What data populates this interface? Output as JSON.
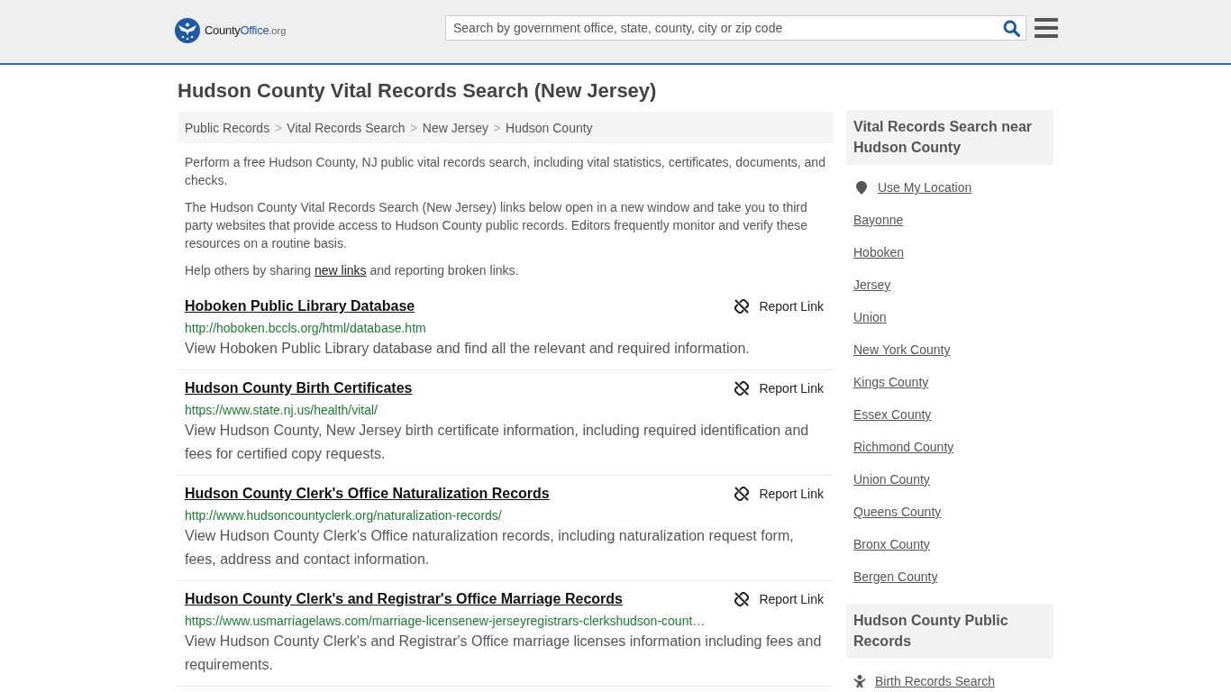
{
  "header": {
    "logo": {
      "county": "County",
      "office": "Office",
      "suffix": ".org"
    },
    "search": {
      "placeholder": "Search by government office, state, county, city or zip code"
    }
  },
  "title": "Hudson County Vital Records Search (New Jersey)",
  "breadcrumb": [
    {
      "label": "Public Records",
      "separator": ">"
    },
    {
      "label": "Vital Records Search",
      "separator": ">"
    },
    {
      "label": "New Jersey",
      "separator": ">"
    },
    {
      "label": "Hudson County"
    }
  ],
  "intro": [
    {
      "text": "Perform a free Hudson County, NJ public vital records search, including vital statistics, certificates, documents, and checks."
    },
    {
      "text": "The Hudson County Vital Records Search (New Jersey) links below open in a new window and take you to third party websites that provide access to Hudson County public records. Editors frequently monitor and verify these resources on a routine basis."
    },
    {
      "text": "Help others by sharing ",
      "link": "new links",
      "text_after": " and reporting broken links."
    }
  ],
  "links": [
    {
      "title": "Hoboken Public Library Database",
      "url": "http://hoboken.bccls.org/html/database.htm",
      "description": "View Hoboken Public Library database and find all the relevant and required information.",
      "report": "Report Link"
    },
    {
      "title": "Hudson County Birth Certificates",
      "url": "https://www.state.nj.us/health/vital/",
      "description": "View Hudson County, New Jersey birth certificate information, including required identification and fees for certified copy requests.",
      "report": "Report Link"
    },
    {
      "title": "Hudson County Clerk's Office Naturalization Records",
      "url": "http://www.hudsoncountyclerk.org/naturalization-records/",
      "description": "View Hudson County Clerk's Office naturalization records, including naturalization request form, fees, address and contact information.",
      "report": "Report Link"
    },
    {
      "title": "Hudson County Clerk's and Registrar's Office Marriage Records",
      "url": "https://www.usmarriagelaws.com/marriage-licensenew-jerseyregistrars-clerkshudson-count…",
      "description": "View Hudson County Clerk's and Registrar's Office marriage licenses information including fees and requirements.",
      "report": "Report Link"
    }
  ],
  "sidebar": [
    {
      "heading": "Vital Records Search near Hudson County",
      "items": [
        {
          "kind": "location",
          "label": "Use My Location"
        },
        {
          "kind": "link",
          "label": "Bayonne"
        },
        {
          "kind": "link",
          "label": "Hoboken"
        },
        {
          "kind": "link",
          "label": "Jersey"
        },
        {
          "kind": "link",
          "label": "Union"
        },
        {
          "kind": "link",
          "label": "New York County"
        },
        {
          "kind": "link",
          "label": "Kings County"
        },
        {
          "kind": "link",
          "label": "Essex County"
        },
        {
          "kind": "link",
          "label": "Richmond County"
        },
        {
          "kind": "link",
          "label": "Union County"
        },
        {
          "kind": "link",
          "label": "Queens County"
        },
        {
          "kind": "link",
          "label": "Bronx County"
        },
        {
          "kind": "link",
          "label": "Bergen County"
        }
      ]
    },
    {
      "heading": "Hudson County Public Records",
      "items": [
        {
          "kind": "birth",
          "label": "Birth Records Search"
        }
      ]
    }
  ]
}
